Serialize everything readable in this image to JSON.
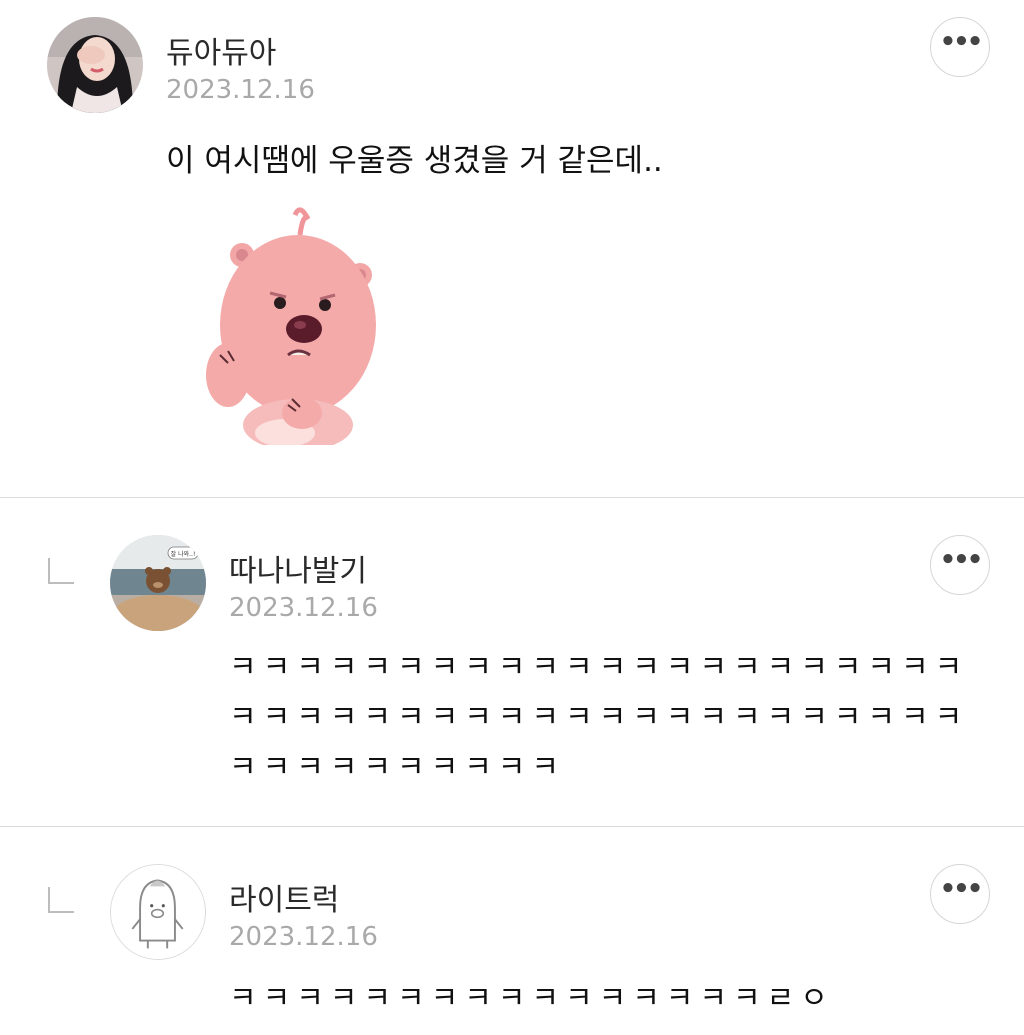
{
  "comments": [
    {
      "author": "듀아듀아",
      "date": "2023.12.16",
      "text": "이 여시땜에 우울증 생겼을 거 같은데..",
      "sticker": "loopy-beaver-sticker",
      "more_label": "•••"
    },
    {
      "author": "따나나발기",
      "date": "2023.12.16",
      "avatar_caption": "잘 나와..!",
      "text": "ㅋㅋㅋㅋㅋㅋㅋㅋㅋㅋㅋㅋㅋㅋㅋㅋㅋㅋㅋㅋㅋㅋㅋㅋㅋㅋㅋㅋㅋㅋㅋㅋㅋㅋㅋㅋㅋㅋㅋㅋㅋㅋㅋㅋㅋㅋㅋㅋㅋㅋㅋㅋㅋㅋ",
      "more_label": "•••"
    },
    {
      "author": "라이트럭",
      "date": "2023.12.16",
      "text": "ㅋㅋㅋㅋㅋㅋㅋㅋㅋㅋㅋㅋㅋㅋㅋㅋㄹㅇ",
      "more_label": "•••"
    }
  ],
  "colors": {
    "divider": "#dcdcdc",
    "date": "#a9a9a9",
    "sticker_pink": "#f2a6a6"
  }
}
